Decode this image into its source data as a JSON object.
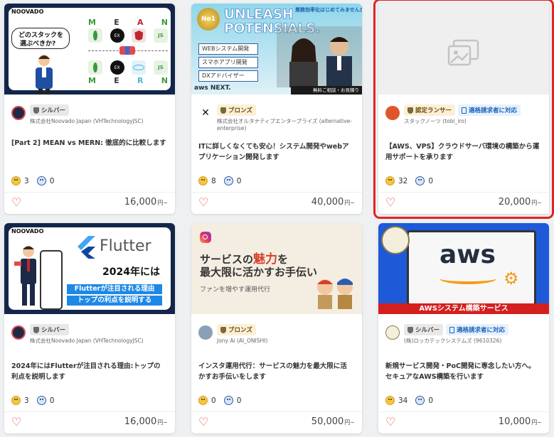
{
  "cards": [
    {
      "thumb_text": {
        "brand": "NOOVADO",
        "q1": "どのスタックを",
        "q2": "選ぶべきか?",
        "mean": [
          "M",
          "E",
          "A",
          "N"
        ],
        "mern": [
          "M",
          "E",
          "R",
          "N"
        ]
      },
      "badges": [
        "シルバー"
      ],
      "seller": "株式会社Noovado Japan (VHTechnologyJSC)",
      "title": "[Part 2] MEAN vs MERN: 徹底的に比較します",
      "good": "3",
      "bad": "0",
      "price": "16,000",
      "unit": "円~"
    },
    {
      "thumb_text": {
        "corner": "業務効率化はじめてみませんか?",
        "headline1": "UNLEASH",
        "headline2": "POTENSIALS.",
        "b1": "WEBシステム開発",
        "b2": "スマホアプリ開発",
        "b3": "DXアドバイザー",
        "medal": "No1",
        "footer": "無料ご相談・お見積り",
        "logos": "aws NEXT."
      },
      "badges": [
        "ブロンズ"
      ],
      "seller": "株式会社オルタナティブエンタープライズ (alternative-enterprise)",
      "title": "ITに詳しくなくても安心！システム開発やwebアプリケーション開発します",
      "good": "8",
      "bad": "0",
      "price": "40,000",
      "unit": "円~"
    },
    {
      "badges": [
        "認定ランサー",
        "適格請求者に対応"
      ],
      "seller": "スタックノーツ (tobi_iro)",
      "title": "【AWS、VPS】クラウドサーバ環境の構築から運用サポートを承ります",
      "good": "32",
      "bad": "0",
      "price": "20,000",
      "unit": "円~"
    },
    {
      "thumb_text": {
        "brand": "NOOVADO",
        "logo": "Flutter",
        "year": "2024年には",
        "l1": "Flutterが注目される理由",
        "l2": "トップの利点を説明する"
      },
      "badges": [
        "シルバー"
      ],
      "seller": "株式会社Noovado Japan (VHTechnologyJSC)",
      "title": "2024年にはFlutterが注目される理由:トップの利点を説明します",
      "good": "3",
      "bad": "0",
      "price": "16,000",
      "unit": "円~"
    },
    {
      "thumb_text": {
        "l1a": "サービスの",
        "l1b": "魅力",
        "l1c": "を",
        "l2": "最大限に活かすお手伝い",
        "sub": "ファンを増やす運用代行"
      },
      "badges": [
        "ブロンズ"
      ],
      "seller": "Jony Ai (AI_ONISHI)",
      "title": "インスタ運用代行：サービスの魅力を最大限に活かすお手伝いをします",
      "good": "0",
      "bad": "0",
      "price": "50,000",
      "unit": "円~"
    },
    {
      "thumb_text": {
        "logo": "aws",
        "banner": "AWSシステム構築サービス"
      },
      "badges": [
        "シルバー",
        "適格請求者に対応"
      ],
      "seller": "(株)ロッカテックシステムズ (9610326)",
      "title": "新規サービス開発・PoC開発に専念したい方へ。セキュアなAWS構築を行います",
      "good": "34",
      "bad": "0",
      "price": "10,000",
      "unit": "円~"
    }
  ]
}
